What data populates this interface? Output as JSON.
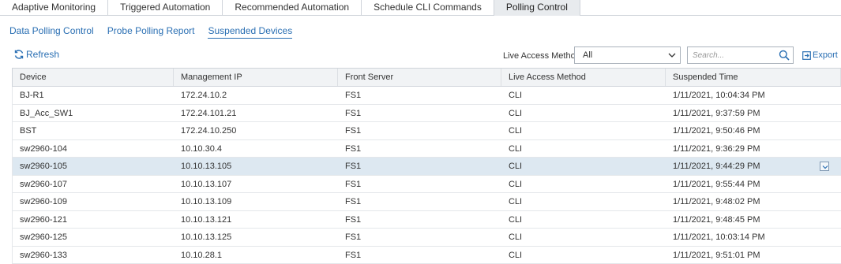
{
  "tabs": [
    {
      "label": "Adaptive Monitoring"
    },
    {
      "label": "Triggered Automation"
    },
    {
      "label": "Recommended Automation"
    },
    {
      "label": "Schedule CLI Commands"
    },
    {
      "label": "Polling Control",
      "active": true
    }
  ],
  "subtabs": [
    {
      "label": "Data Polling Control"
    },
    {
      "label": "Probe Polling Report"
    },
    {
      "label": "Suspended Devices",
      "active": true
    }
  ],
  "toolbar": {
    "refresh_label": "Refresh",
    "live_access_label": "Live Access Method:",
    "live_access_value": "All",
    "search_placeholder": "Search...",
    "export_label": "Export"
  },
  "table": {
    "headers": [
      "Device",
      "Management IP",
      "Front Server",
      "Live Access Method",
      "Suspended Time"
    ],
    "rows": [
      [
        "BJ-R1",
        "172.24.10.2",
        "FS1",
        "CLI",
        "1/11/2021, 10:04:34 PM"
      ],
      [
        "BJ_Acc_SW1",
        "172.24.101.21",
        "FS1",
        "CLI",
        "1/11/2021, 9:37:59 PM"
      ],
      [
        "BST",
        "172.24.10.250",
        "FS1",
        "CLI",
        "1/11/2021, 9:50:46 PM"
      ],
      [
        "sw2960-104",
        "10.10.30.4",
        "FS1",
        "CLI",
        "1/11/2021, 9:36:29 PM"
      ],
      [
        "sw2960-105",
        "10.10.13.105",
        "FS1",
        "CLI",
        "1/11/2021, 9:44:29 PM"
      ],
      [
        "sw2960-107",
        "10.10.13.107",
        "FS1",
        "CLI",
        "1/11/2021, 9:55:44 PM"
      ],
      [
        "sw2960-109",
        "10.10.13.109",
        "FS1",
        "CLI",
        "1/11/2021, 9:48:02 PM"
      ],
      [
        "sw2960-121",
        "10.10.13.121",
        "FS1",
        "CLI",
        "1/11/2021, 9:48:45 PM"
      ],
      [
        "sw2960-125",
        "10.10.13.125",
        "FS1",
        "CLI",
        "1/11/2021, 10:03:14 PM"
      ],
      [
        "sw2960-133",
        "10.10.28.1",
        "FS1",
        "CLI",
        "1/11/2021, 9:51:01 PM"
      ]
    ],
    "selected_row": 4
  },
  "colors": {
    "link": "#2a6fb3",
    "active_tab_bg": "#e8ebee",
    "selected_row_bg": "#dde8f1",
    "header_bg": "#f1f3f5"
  },
  "icons": {
    "refresh": "refresh-icon",
    "dropdown": "chevron-down-icon",
    "search": "search-icon",
    "export": "export-icon"
  }
}
